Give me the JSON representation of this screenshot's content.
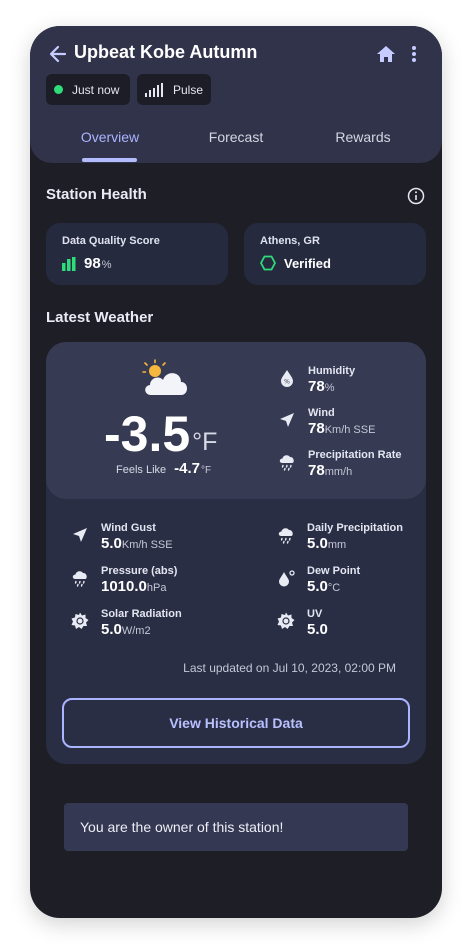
{
  "header": {
    "title": "Upbeat Kobe Autumn",
    "chips": {
      "time": "Just now",
      "signal": "Pulse"
    },
    "tabs": [
      "Overview",
      "Forecast",
      "Rewards"
    ]
  },
  "station_health": {
    "title": "Station Health",
    "quality": {
      "label": "Data Quality Score",
      "value": "98",
      "unit": "%"
    },
    "location": {
      "label": "Athens, GR",
      "status": "Verified"
    }
  },
  "latest_weather": {
    "title": "Latest Weather",
    "temperature": {
      "value": "-3.5",
      "unit": "°F"
    },
    "feels_like": {
      "label": "Feels Like",
      "value": "-4.7",
      "unit": "°F"
    },
    "hero_metrics": [
      {
        "label": "Humidity",
        "value": "78",
        "unit": "%",
        "icon": "humidity-icon"
      },
      {
        "label": "Wind",
        "value": "78",
        "unit": "Km/h SSE",
        "icon": "wind-arrow-icon"
      },
      {
        "label": "Precipitation Rate",
        "value": "78",
        "unit": "mm/h",
        "icon": "rain-cloud-icon"
      }
    ],
    "details": [
      {
        "label": "Wind Gust",
        "value": "5.0",
        "unit": "Km/h SSE",
        "icon": "wind-arrow-icon"
      },
      {
        "label": "Daily Precipitation",
        "value": "5.0",
        "unit": "mm",
        "icon": "rain-cloud-icon"
      },
      {
        "label": "Pressure (abs)",
        "value": "1010.0",
        "unit": "hPa",
        "icon": "pressure-cloud-icon"
      },
      {
        "label": "Dew Point",
        "value": "5.0",
        "unit": "°C",
        "icon": "dew-point-icon"
      },
      {
        "label": "Solar Radiation",
        "value": "5.0",
        "unit": "W/m2",
        "icon": "sun-gear-icon"
      },
      {
        "label": "UV",
        "value": "5.0",
        "unit": "",
        "icon": "uv-sun-icon"
      }
    ],
    "updated": "Last updated on Jul 10, 2023, 02:00 PM",
    "history_button": "View Historical Data"
  },
  "owner_notice": "You are the owner of this station!",
  "colors": {
    "background": "#1e1f26",
    "header": "#30334a",
    "accent": "#aab4ff",
    "live_dot": "#2fdc7a",
    "verified": "#2fdc7a"
  }
}
